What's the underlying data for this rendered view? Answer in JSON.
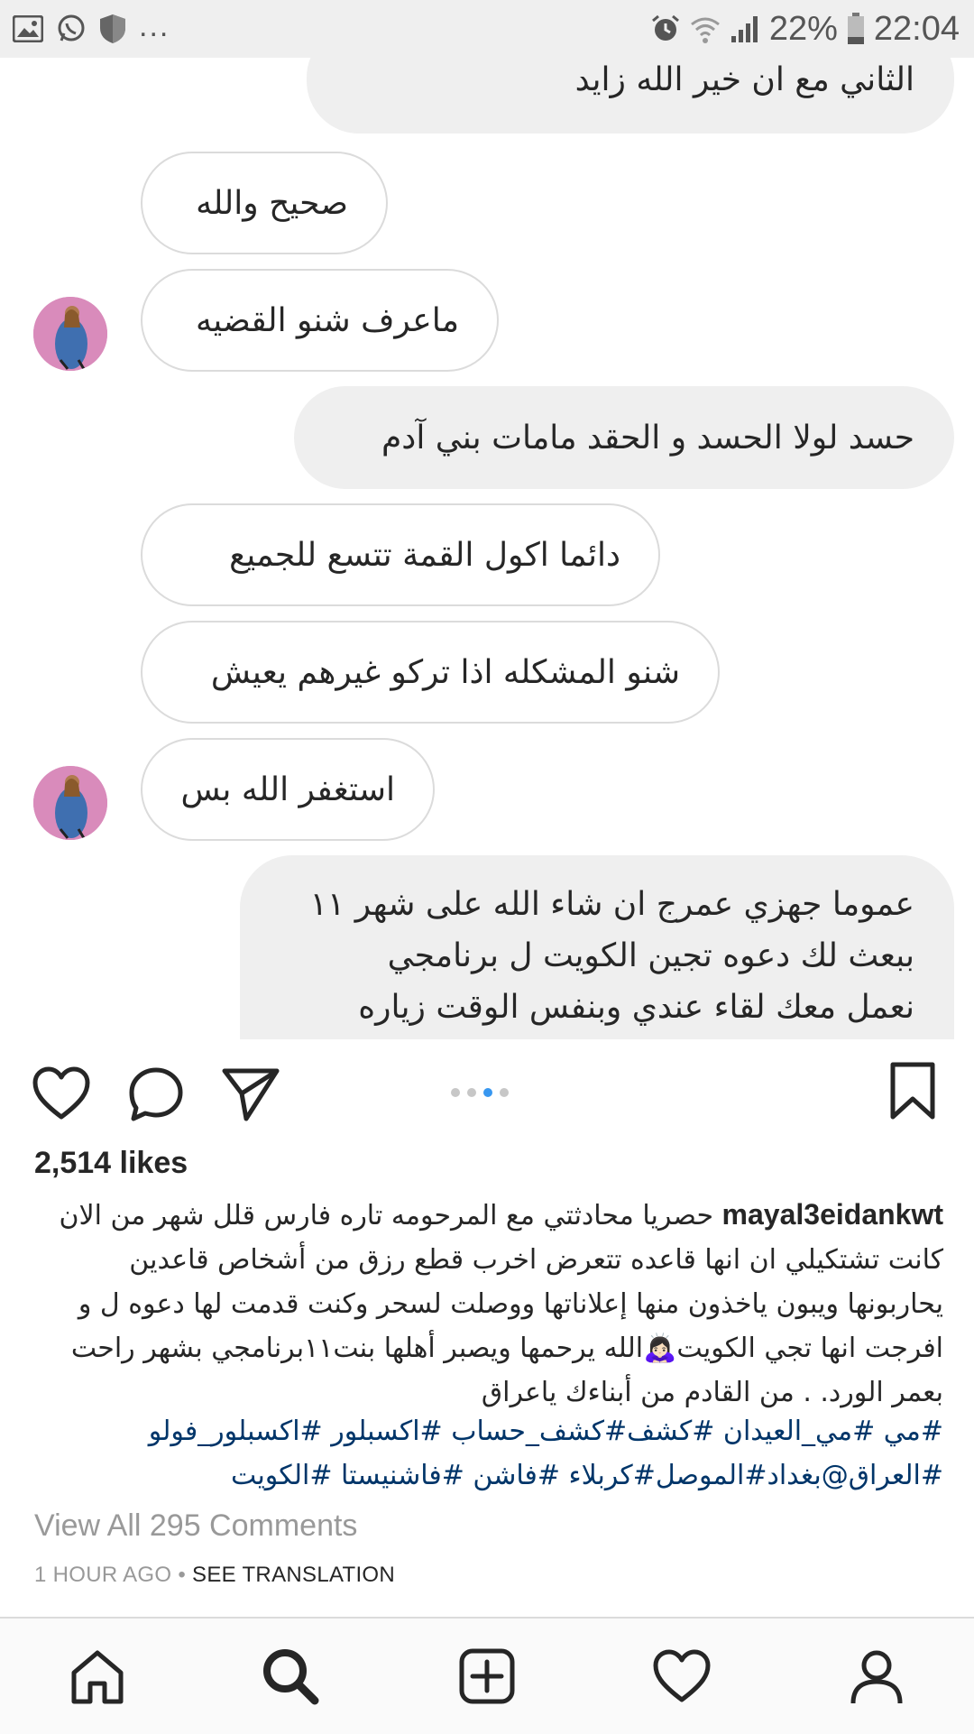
{
  "status_bar": {
    "left_icons": [
      "gallery-icon",
      "whatsapp-icon",
      "shield-icon"
    ],
    "more": "...",
    "battery": "22%",
    "time": "22:04"
  },
  "chat": {
    "messages": [
      {
        "side": "outgoing",
        "text": "الثاني مع ان خير الله زايد"
      },
      {
        "side": "incoming",
        "text": "صحيح والله"
      },
      {
        "side": "incoming",
        "text": "ماعرف شنو القضيه"
      },
      {
        "side": "outgoing",
        "text": "حسد لولا الحسد و الحقد مامات بني آدم"
      },
      {
        "side": "incoming",
        "text": "دائما اكول القمة تتسع للجميع"
      },
      {
        "side": "incoming",
        "text": "شنو المشكله اذا تركو غيرهم يعيش"
      },
      {
        "side": "incoming",
        "text": "استغفر الله بس"
      },
      {
        "side": "outgoing",
        "lines": [
          "عموما جهزي عمرج ان شاء الله على شهر ١١",
          "ببعث لك دعوه تجين الكويت ل برنامجي",
          "نعمل معك لقاء عندي وبنفس الوقت زياره"
        ]
      }
    ]
  },
  "post": {
    "carousel": {
      "count": 4,
      "active_index": 3
    },
    "likes": "2,514 likes",
    "username": "mayal3eidankwt",
    "caption": "حصريا محادثتي مع المرحومه تاره فارس قلل شهر من الان كانت تشتكيلي ان انها قاعده تتعرض اخرب قطع رزق من أشخاص قاعدين يحاربونها ويبون ياخذون منها إعلاناتها ووصلت لسحر وكنت قدمت لها دعوه ل و افرجت انها تجي الكويت🙇🏻‍♀️الله يرحمها ويصبر أهلها بنت١١برنامجي بشهر راحت بعمر الورد. . من القادم من أبناءك ياعراق",
    "hashtags": [
      "#مي #مي_العيدان #كشف#كشف_حساب #اكسبلور #اكسبلور_فولو",
      "#العراق@بغداد#الموصل#كربلاء #فاشن #فاشنيستا #الكويت"
    ],
    "view_comments": "View All 295 Comments",
    "time_ago": "1 HOUR AGO",
    "separator": "•",
    "see_translation": "SEE TRANSLATION"
  },
  "accent_color": "#3897f0",
  "hashtag_color": "#003569"
}
